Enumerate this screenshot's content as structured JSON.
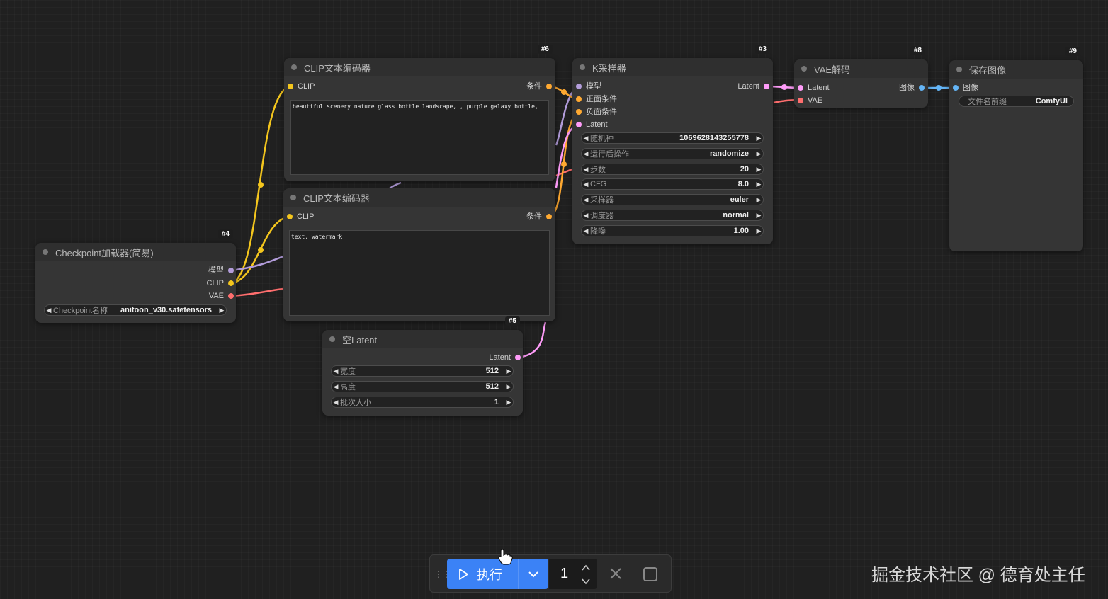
{
  "nodes": {
    "clip_pos": {
      "id": "#6",
      "title": "CLIP文本编码器",
      "input_clip": "CLIP",
      "output": "条件",
      "text": "beautiful scenery nature glass bottle landscape, , purple galaxy bottle,"
    },
    "clip_neg": {
      "id": "",
      "title": "CLIP文本编码器",
      "input_clip": "CLIP",
      "output": "条件",
      "text": "text, watermark"
    },
    "checkpoint": {
      "id": "#4",
      "title": "Checkpoint加载器(简易)",
      "out_model": "模型",
      "out_clip": "CLIP",
      "out_vae": "VAE",
      "widget_label": "Checkpoint名称",
      "widget_value": "anitoon_v30.safetensors"
    },
    "latent": {
      "id": "#5",
      "title": "空Latent",
      "output": "Latent",
      "widgets": [
        {
          "label": "宽度",
          "value": "512"
        },
        {
          "label": "高度",
          "value": "512"
        },
        {
          "label": "批次大小",
          "value": "1"
        }
      ]
    },
    "ksampler": {
      "id": "#3",
      "title": "K采样器",
      "inputs": [
        "模型",
        "正面条件",
        "负面条件",
        "Latent"
      ],
      "output": "Latent",
      "widgets": [
        {
          "label": "随机种",
          "value": "1069628143255778"
        },
        {
          "label": "运行后操作",
          "value": "randomize"
        },
        {
          "label": "步数",
          "value": "20"
        },
        {
          "label": "CFG",
          "value": "8.0"
        },
        {
          "label": "采样器",
          "value": "euler"
        },
        {
          "label": "调度器",
          "value": "normal"
        },
        {
          "label": "降噪",
          "value": "1.00"
        }
      ]
    },
    "vae": {
      "id": "#8",
      "title": "VAE解码",
      "in_latent": "Latent",
      "in_vae": "VAE",
      "output": "图像"
    },
    "save": {
      "id": "#9",
      "title": "保存图像",
      "input": "图像",
      "widget_label": "文件名前缀",
      "widget_value": "ComfyUI"
    }
  },
  "toolbar": {
    "run_label": "执行",
    "queue_count": "1"
  },
  "watermark": "掘金技术社区 @ 德育处主任",
  "colors": {
    "clip": "#f4c61d",
    "model": "#b39ddb",
    "vae": "#ff6e6e",
    "conditioning": "#ffa931",
    "latent": "#ff9cf9",
    "image": "#64b5f6",
    "run_button": "#3b82f6"
  }
}
